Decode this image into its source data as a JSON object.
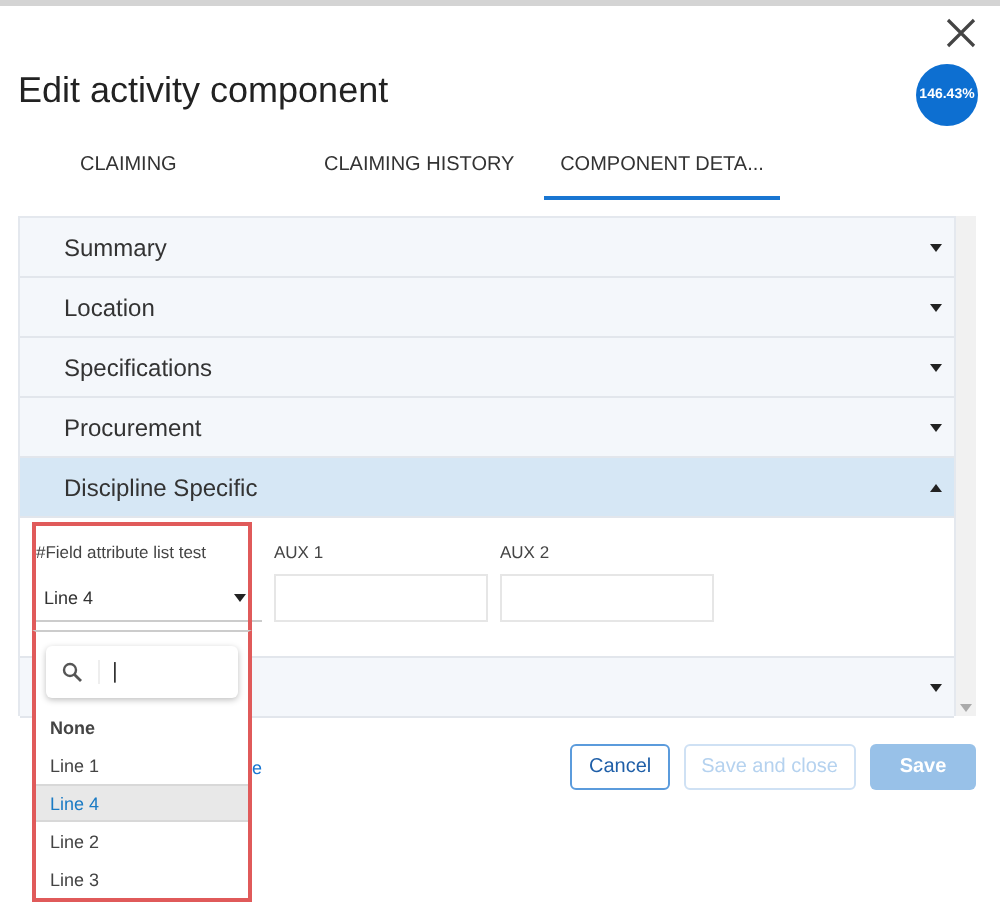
{
  "dialog": {
    "title": "Edit activity component",
    "badge": "146.43%"
  },
  "tabs": [
    {
      "label": "CLAIMING",
      "selected": false
    },
    {
      "label": "CLAIMING HISTORY",
      "selected": false
    },
    {
      "label": "COMPONENT DETA...",
      "selected": true
    }
  ],
  "sections": [
    {
      "title": "Summary",
      "expanded": false
    },
    {
      "title": "Location",
      "expanded": false
    },
    {
      "title": "Specifications",
      "expanded": false
    },
    {
      "title": "Procurement",
      "expanded": false
    },
    {
      "title": "Discipline Specific",
      "expanded": true
    },
    {
      "expanded": false
    }
  ],
  "fields": [
    {
      "kind": "select",
      "label": "#Field attribute list test",
      "value": "Line 4"
    },
    {
      "kind": "text",
      "label": "AUX 1"
    },
    {
      "kind": "text",
      "label": "AUX 2"
    }
  ],
  "dropdown": {
    "search_value": "|",
    "options": [
      {
        "label": "None",
        "selected": false,
        "kind": "header"
      },
      {
        "label": "Line 1",
        "selected": false
      },
      {
        "label": "Line 4",
        "selected": true
      },
      {
        "label": "Line 2",
        "selected": false
      },
      {
        "label": "Line 3",
        "selected": false
      }
    ]
  },
  "footer_link": "e",
  "buttons": [
    {
      "label": "Cancel",
      "kind": "outline",
      "disabled": false
    },
    {
      "label": "Save and close",
      "kind": "outline",
      "disabled": true
    },
    {
      "label": "Save",
      "kind": "primary",
      "disabled": true
    }
  ]
}
